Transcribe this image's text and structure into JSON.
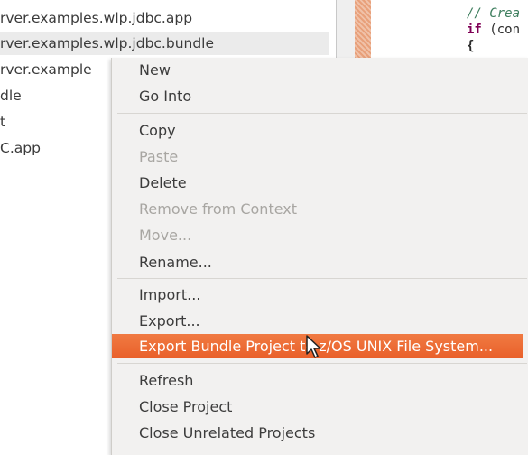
{
  "tree": {
    "rows": [
      "rver.examples.wlp.jdbc.app",
      "rver.examples.wlp.jdbc.bundle",
      "rver.example",
      "dle",
      "t",
      "C.app"
    ]
  },
  "editor": {
    "comment": "// Crea",
    "if_keyword": "if",
    "if_rest": " (con",
    "brace": "{"
  },
  "menu": {
    "new": "New",
    "go_into": "Go Into",
    "copy": "Copy",
    "paste": "Paste",
    "delete": "Delete",
    "remove_from_context": "Remove from Context",
    "move": "Move...",
    "rename": "Rename...",
    "import": "Import...",
    "export": "Export...",
    "export_bundle": "Export Bundle Project to z/OS UNIX File System...",
    "refresh": "Refresh",
    "close_project": "Close Project",
    "close_unrelated": "Close Unrelated Projects"
  },
  "colors": {
    "highlight": "#ee6d36",
    "menu_bg": "#f2f1f0",
    "disabled_text": "#a8a6a2"
  }
}
